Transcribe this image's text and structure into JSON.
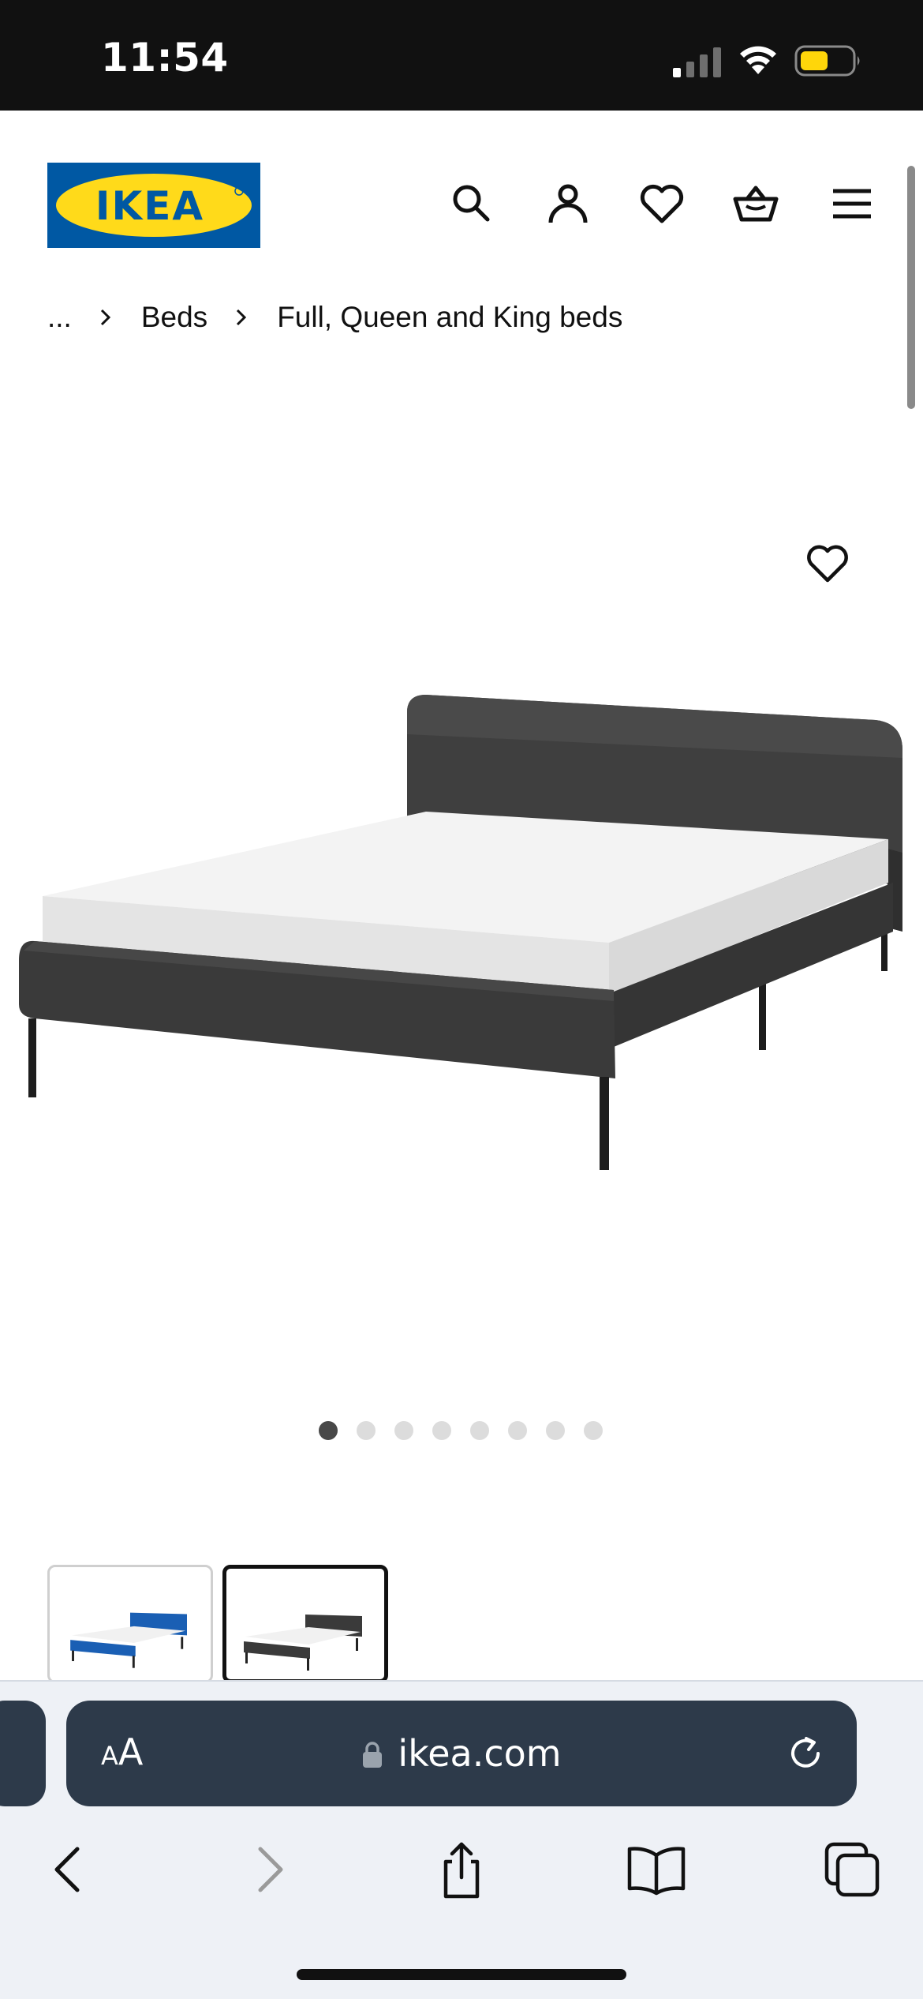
{
  "status_bar": {
    "time": "11:54",
    "signal_icon": "cellular-signal-icon",
    "wifi_icon": "wifi-icon",
    "battery_icon": "battery-low-power-icon",
    "battery_color": "#ffd60a"
  },
  "header": {
    "logo_text": "IKEA",
    "logo_colors": {
      "background": "#0058a3",
      "ellipse": "#ffda1a",
      "text": "#0058a3"
    },
    "icons": [
      "search-icon",
      "user-icon",
      "heart-icon",
      "shopping-basket-icon",
      "menu-icon"
    ]
  },
  "breadcrumb": {
    "items": [
      "...",
      "Beds",
      "Full, Queen and King beds"
    ],
    "separator_icon": "chevron-right-icon"
  },
  "product": {
    "image_description_icon": "upholstered-bed-frame-dark-grey",
    "favorite_icon": "heart-icon",
    "carousel": {
      "total": 8,
      "active_index": 0
    },
    "variant_thumbnails": [
      {
        "color": "#1a5fb4",
        "icon": "bed-blue-thumbnail",
        "selected": false
      },
      {
        "color": "#3a3a3a",
        "icon": "bed-dark-grey-thumbnail",
        "selected": true
      }
    ]
  },
  "browser": {
    "text_size_label": "AA",
    "url": "ikea.com",
    "lock_icon": "lock-icon",
    "reload_icon": "reload-icon",
    "toolbar": [
      "back-icon",
      "forward-icon",
      "share-icon",
      "bookmarks-icon",
      "tabs-icon"
    ]
  }
}
